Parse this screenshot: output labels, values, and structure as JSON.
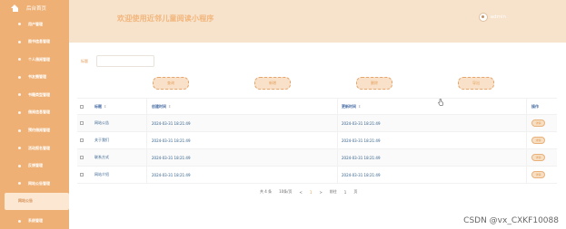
{
  "sidebar": {
    "header": "后台首页",
    "items": [
      {
        "label": "用户管理"
      },
      {
        "label": "图书信息管理"
      },
      {
        "label": "个人借阅管理"
      },
      {
        "label": "书友圈管理"
      },
      {
        "label": "书籍类型管理"
      },
      {
        "label": "借阅信息管理"
      },
      {
        "label": "预约借阅管理"
      },
      {
        "label": "活动报名管理"
      },
      {
        "label": "反馈管理"
      },
      {
        "label": "网站公告管理"
      },
      {
        "label": "网站公告"
      },
      {
        "label": "系统管理"
      }
    ]
  },
  "header": {
    "title": "欢迎使用近邻儿童阅读小程序",
    "username": "admin"
  },
  "search": {
    "label": "标题"
  },
  "toolbar": {
    "query_label": "查询",
    "add_label": "新增",
    "delete_label": "删除",
    "export_label": "导出"
  },
  "table": {
    "headers": {
      "title": "标题",
      "created": "创建时间",
      "updated": "更新时间",
      "op": "操作",
      "sort": "⇕"
    },
    "rows": [
      {
        "title": "网站公告",
        "created": "2024-03-31 18:21:49",
        "updated": "2024-03-31 18:21:49",
        "op": "详情"
      },
      {
        "title": "关于我们",
        "created": "2024-03-31 18:21:49",
        "updated": "2024-03-31 18:21:49",
        "op": "详情"
      },
      {
        "title": "联系方式",
        "created": "2024-03-31 18:21:49",
        "updated": "2024-03-31 18:21:49",
        "op": "详情"
      },
      {
        "title": "网站介绍",
        "created": "2024-03-31 18:21:49",
        "updated": "2024-03-31 18:21:49",
        "op": "详情"
      }
    ]
  },
  "pager": {
    "total": "共 4 条",
    "per_page": "10条/页",
    "prev": "<",
    "page": "1",
    "next": ">",
    "goto": "前往",
    "goto_page": "1",
    "page_suffix": "页"
  },
  "watermark": "CSDN @vx_CXKF10088",
  "colors": {
    "sidebar_bg": "#eeb074",
    "header_bg": "#f7e2cb",
    "accent": "#e69f5c"
  }
}
